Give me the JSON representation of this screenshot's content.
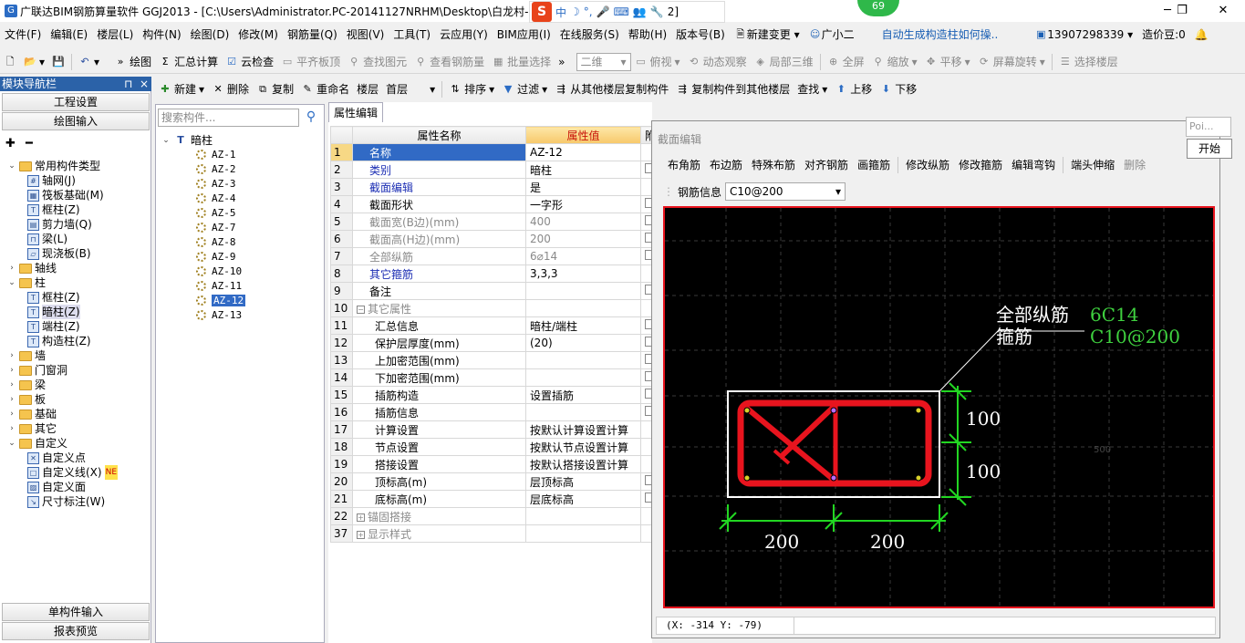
{
  "titlebar": {
    "app_title": "广联达BIM钢筋算量软件 GGJ2013 - [C:\\Users\\Administrator.PC-20141127NRHM\\Desktop\\白龙村-",
    "title_tail": "2]",
    "notif_count": "69"
  },
  "ime": {
    "s": "S",
    "lang": "中",
    "moon": "☽",
    "punct": "°,",
    "mic": "🎤",
    "kbd": "⌨",
    "user": "👥",
    "tool": "🔧"
  },
  "menu": [
    "文件(F)",
    "编辑(E)",
    "楼层(L)",
    "构件(N)",
    "绘图(D)",
    "修改(M)",
    "钢筋量(Q)",
    "视图(V)",
    "工具(T)",
    "云应用(Y)",
    "BIM应用(I)",
    "在线服务(S)",
    "帮助(H)",
    "版本号(B)"
  ],
  "menu_extra": {
    "new_change": "新建变更",
    "assistant": "广小二",
    "tip": "自动生成构造柱如何操..",
    "phone": "13907298339",
    "beans": "造价豆:0"
  },
  "toolbar1": {
    "draw": "绘图",
    "sum": "汇总计算",
    "cloud": "云检查",
    "flat": "平齐板顶",
    "find": "查找图元",
    "rebar_qty": "查看钢筋量",
    "batch": "批量选择",
    "view_mode": "二维",
    "top": "俯视",
    "dyn": "动态观察",
    "local3d": "局部三维",
    "full": "全屏",
    "zoom": "缩放",
    "pan": "平移",
    "rotate": "屏幕旋转",
    "select_floor": "选择楼层"
  },
  "leftpanel": {
    "header": "模块导航栏",
    "pin": "ᵖ",
    "close": "×",
    "btn_project": "工程设置",
    "btn_draw": "绘图输入",
    "btn_single": "单构件输入",
    "btn_report": "报表预览"
  },
  "tree": [
    {
      "label": "常用构件类型",
      "level": 0,
      "type": "folder",
      "exp": "⌄"
    },
    {
      "label": "轴网(J)",
      "level": 1,
      "type": "comp",
      "ic": "#"
    },
    {
      "label": "筏板基础(M)",
      "level": 1,
      "type": "comp",
      "ic": "▦"
    },
    {
      "label": "框柱(Z)",
      "level": 1,
      "type": "comp",
      "ic": "T"
    },
    {
      "label": "剪力墙(Q)",
      "level": 1,
      "type": "comp",
      "ic": "▤"
    },
    {
      "label": "梁(L)",
      "level": 1,
      "type": "comp",
      "ic": "⊓"
    },
    {
      "label": "现浇板(B)",
      "level": 1,
      "type": "comp",
      "ic": "▱"
    },
    {
      "label": "轴线",
      "level": 0,
      "type": "folder",
      "exp": "›"
    },
    {
      "label": "柱",
      "level": 0,
      "type": "folder",
      "exp": "⌄"
    },
    {
      "label": "框柱(Z)",
      "level": 1,
      "type": "comp",
      "ic": "T"
    },
    {
      "label": "暗柱(Z)",
      "level": 1,
      "type": "comp",
      "ic": "T",
      "selected": true
    },
    {
      "label": "端柱(Z)",
      "level": 1,
      "type": "comp",
      "ic": "T"
    },
    {
      "label": "构造柱(Z)",
      "level": 1,
      "type": "comp",
      "ic": "T"
    },
    {
      "label": "墙",
      "level": 0,
      "type": "folder",
      "exp": "›"
    },
    {
      "label": "门窗洞",
      "level": 0,
      "type": "folder",
      "exp": "›"
    },
    {
      "label": "梁",
      "level": 0,
      "type": "folder",
      "exp": "›"
    },
    {
      "label": "板",
      "level": 0,
      "type": "folder",
      "exp": "›"
    },
    {
      "label": "基础",
      "level": 0,
      "type": "folder",
      "exp": "›"
    },
    {
      "label": "其它",
      "level": 0,
      "type": "folder",
      "exp": "›"
    },
    {
      "label": "自定义",
      "level": 0,
      "type": "folder",
      "exp": "⌄"
    },
    {
      "label": "自定义点",
      "level": 1,
      "type": "comp",
      "ic": "✕"
    },
    {
      "label": "自定义线(X)",
      "level": 1,
      "type": "comp",
      "ic": "□",
      "badge": "NE"
    },
    {
      "label": "自定义面",
      "level": 1,
      "type": "comp",
      "ic": "▨"
    },
    {
      "label": "尺寸标注(W)",
      "level": 1,
      "type": "comp",
      "ic": "↘"
    }
  ],
  "toolbar2": {
    "new": "新建",
    "delete": "删除",
    "copy": "复制",
    "rename": "重命名",
    "floor_lbl": "楼层",
    "floor": "首层",
    "sort": "排序",
    "filter": "过滤",
    "copy_from": "从其他楼层复制构件",
    "copy_to": "复制构件到其他楼层",
    "find": "查找",
    "up": "上移",
    "down": "下移"
  },
  "complist": {
    "search_placeholder": "搜索构件...",
    "root": "暗柱",
    "items": [
      "AZ-1",
      "AZ-2",
      "AZ-3",
      "AZ-4",
      "AZ-5",
      "AZ-7",
      "AZ-8",
      "AZ-9",
      "AZ-10",
      "AZ-11",
      "AZ-12",
      "AZ-13"
    ],
    "selected": "AZ-12"
  },
  "props": {
    "tab": "属性编辑",
    "col_name": "属性名称",
    "col_value": "属性值",
    "col_extra": "附",
    "rows": [
      {
        "n": "1",
        "name": "名称",
        "val": "AZ-12",
        "style": "blue",
        "sel": true
      },
      {
        "n": "2",
        "name": "类别",
        "val": "暗柱",
        "style": "blue",
        "cb": true
      },
      {
        "n": "3",
        "name": "截面编辑",
        "val": "是",
        "style": "blue",
        "cb": false
      },
      {
        "n": "4",
        "name": "截面形状",
        "val": "一字形",
        "style": "",
        "cb": true
      },
      {
        "n": "5",
        "name": "截面宽(B边)(mm)",
        "val": "400",
        "style": "grey",
        "cb": true
      },
      {
        "n": "6",
        "name": "截面高(H边)(mm)",
        "val": "200",
        "style": "grey",
        "cb": true
      },
      {
        "n": "7",
        "name": "全部纵筋",
        "val": "6⌀14",
        "style": "grey",
        "cb": true
      },
      {
        "n": "8",
        "name": "其它箍筋",
        "val": "3,3,3",
        "style": "blue",
        "cb": false
      },
      {
        "n": "9",
        "name": "备注",
        "val": "",
        "style": "",
        "cb": true
      },
      {
        "n": "10",
        "name": "其它属性",
        "val": "",
        "style": "grey",
        "group": "−"
      },
      {
        "n": "11",
        "name": "汇总信息",
        "val": "暗柱/端柱",
        "style": "",
        "indent": true,
        "cb": true
      },
      {
        "n": "12",
        "name": "保护层厚度(mm)",
        "val": "(20)",
        "style": "",
        "indent": true,
        "cb": true
      },
      {
        "n": "13",
        "name": "上加密范围(mm)",
        "val": "",
        "style": "",
        "indent": true,
        "cb": true
      },
      {
        "n": "14",
        "name": "下加密范围(mm)",
        "val": "",
        "style": "",
        "indent": true,
        "cb": true
      },
      {
        "n": "15",
        "name": "插筋构造",
        "val": "设置插筋",
        "style": "",
        "indent": true,
        "cb": true
      },
      {
        "n": "16",
        "name": "插筋信息",
        "val": "",
        "style": "",
        "indent": true,
        "cb": true
      },
      {
        "n": "17",
        "name": "计算设置",
        "val": "按默认计算设置计算",
        "style": "",
        "indent": true,
        "cb": false
      },
      {
        "n": "18",
        "name": "节点设置",
        "val": "按默认节点设置计算",
        "style": "",
        "indent": true,
        "cb": false
      },
      {
        "n": "19",
        "name": "搭接设置",
        "val": "按默认搭接设置计算",
        "style": "",
        "indent": true,
        "cb": false
      },
      {
        "n": "20",
        "name": "顶标高(m)",
        "val": "层顶标高",
        "style": "",
        "indent": true,
        "cb": true
      },
      {
        "n": "21",
        "name": "底标高(m)",
        "val": "层底标高",
        "style": "",
        "indent": true,
        "cb": true
      },
      {
        "n": "22",
        "name": "锚固搭接",
        "val": "",
        "style": "grey",
        "group": "+"
      },
      {
        "n": "37",
        "name": "显示样式",
        "val": "",
        "style": "grey",
        "group": "+"
      }
    ]
  },
  "dialog": {
    "title": "截面编辑",
    "buttons": [
      "布角筋",
      "布边筋",
      "特殊布筋",
      "对齐钢筋",
      "画箍筋",
      "修改纵筋",
      "修改箍筋",
      "编辑弯钩",
      "端头伸缩",
      "删除"
    ],
    "rebar_info_lbl": "钢筋信息",
    "rebar_info": "C10@200",
    "status": "(X: -314 Y: -79)"
  },
  "drawing": {
    "label_long": "全部纵筋",
    "val_long": "6C14",
    "label_stir": "箍筋",
    "val_stir": "C10@200",
    "dim_h1": "100",
    "dim_h2": "100",
    "dim_w1": "200",
    "dim_w2": "200",
    "faint": "500"
  },
  "popup": {
    "poi": "Poi...",
    "start": "开始"
  },
  "colors": {
    "accent": "#316ac5",
    "rebar": "#e8141e",
    "dim": "#22d622",
    "label_green": "#3fd13f"
  }
}
